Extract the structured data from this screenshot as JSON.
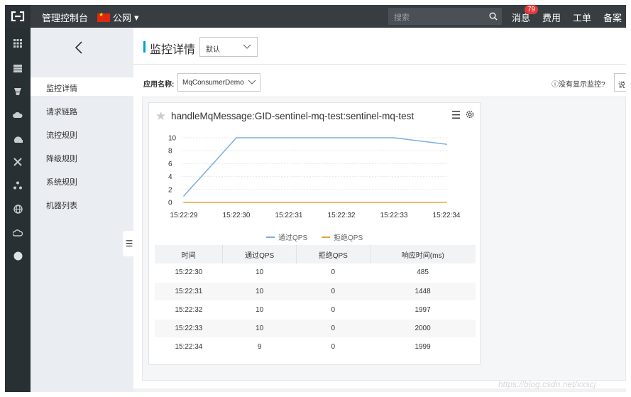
{
  "topbar": {
    "console_label": "管理控制台",
    "region_label": "公网",
    "search_placeholder": "搜索",
    "messages_label": "消息",
    "messages_count": "79",
    "billing_label": "费用",
    "tickets_label": "工单",
    "filing_label": "备案"
  },
  "sidebar": {
    "items": [
      {
        "label": "监控详情"
      },
      {
        "label": "请求链路"
      },
      {
        "label": "流控规则"
      },
      {
        "label": "降级规则"
      },
      {
        "label": "系统规则"
      },
      {
        "label": "机器列表"
      }
    ]
  },
  "header": {
    "title": "监控详情",
    "select_value": "默认"
  },
  "filter": {
    "app_label": "应用名称:",
    "app_value": "MqConsumerDemo",
    "no_monitor_text": "没有显示监控?",
    "edge_button": "说"
  },
  "card": {
    "title": "handleMqMessage:GID-sentinel-mq-test:sentinel-mq-test"
  },
  "chart_data": {
    "type": "line",
    "x": [
      "15:22:29",
      "15:22:30",
      "15:22:31",
      "15:22:32",
      "15:22:33",
      "15:22:34"
    ],
    "y_ticks": [
      "10",
      "8",
      "6",
      "4",
      "2",
      "0"
    ],
    "ylim": [
      0,
      10
    ],
    "grid": true,
    "legend_position": "bottom",
    "series": [
      {
        "name": "通过QPS",
        "color": "#7aaddf",
        "values": [
          1,
          10,
          10,
          10,
          10,
          9
        ]
      },
      {
        "name": "拒绝QPS",
        "color": "#e8a33d",
        "values": [
          0,
          0,
          0,
          0,
          0,
          0
        ]
      }
    ]
  },
  "table": {
    "headers": [
      "时间",
      "通过QPS",
      "拒绝QPS",
      "响应时间(ms)"
    ],
    "rows": [
      [
        "15:22:30",
        "10",
        "0",
        "485"
      ],
      [
        "15:22:31",
        "10",
        "0",
        "1448"
      ],
      [
        "15:22:32",
        "10",
        "0",
        "1997"
      ],
      [
        "15:22:33",
        "10",
        "0",
        "2000"
      ],
      [
        "15:22:34",
        "9",
        "0",
        "1999"
      ]
    ]
  },
  "watermark": "https://blog.csdn.net/xxscj"
}
